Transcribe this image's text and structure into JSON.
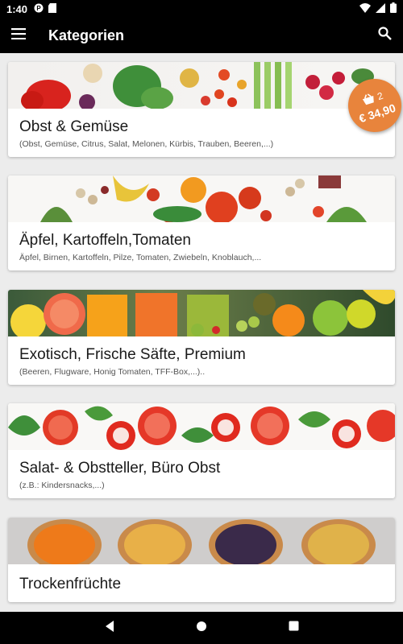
{
  "status_bar": {
    "time": "1:40",
    "icons": [
      "app-notification-icon",
      "sd-card-icon",
      "wifi-icon",
      "signal-icon",
      "battery-icon"
    ]
  },
  "app_bar": {
    "title": "Kategorien",
    "icons": [
      "menu-icon",
      "search-icon"
    ]
  },
  "cart": {
    "count": "2",
    "amount": "€ 34,90",
    "color": "#e8843c"
  },
  "categories": [
    {
      "name": "Obst & Gemüse",
      "description": "(Obst, Gemüse, Citrus, Salat, Melonen, Kürbis, Trauben, Beeren,...)"
    },
    {
      "name": "Äpfel, Kartoffeln,Tomaten",
      "description": "Äpfel, Birnen, Kartoffeln, Pilze, Tomaten, Zwiebeln, Knoblauch,..."
    },
    {
      "name": "Exotisch, Frische Säfte, Premium",
      "description": "(Beeren, Flugware, Honig Tomaten, TFF-Box,...).."
    },
    {
      "name": "Salat- & Obstteller, Büro Obst",
      "description": "(z.B.: Kindersnacks,...)"
    },
    {
      "name": "Trockenfrüchte",
      "description": ""
    }
  ],
  "nav_bar": {
    "icons": [
      "back-icon",
      "home-icon",
      "recents-icon"
    ]
  }
}
